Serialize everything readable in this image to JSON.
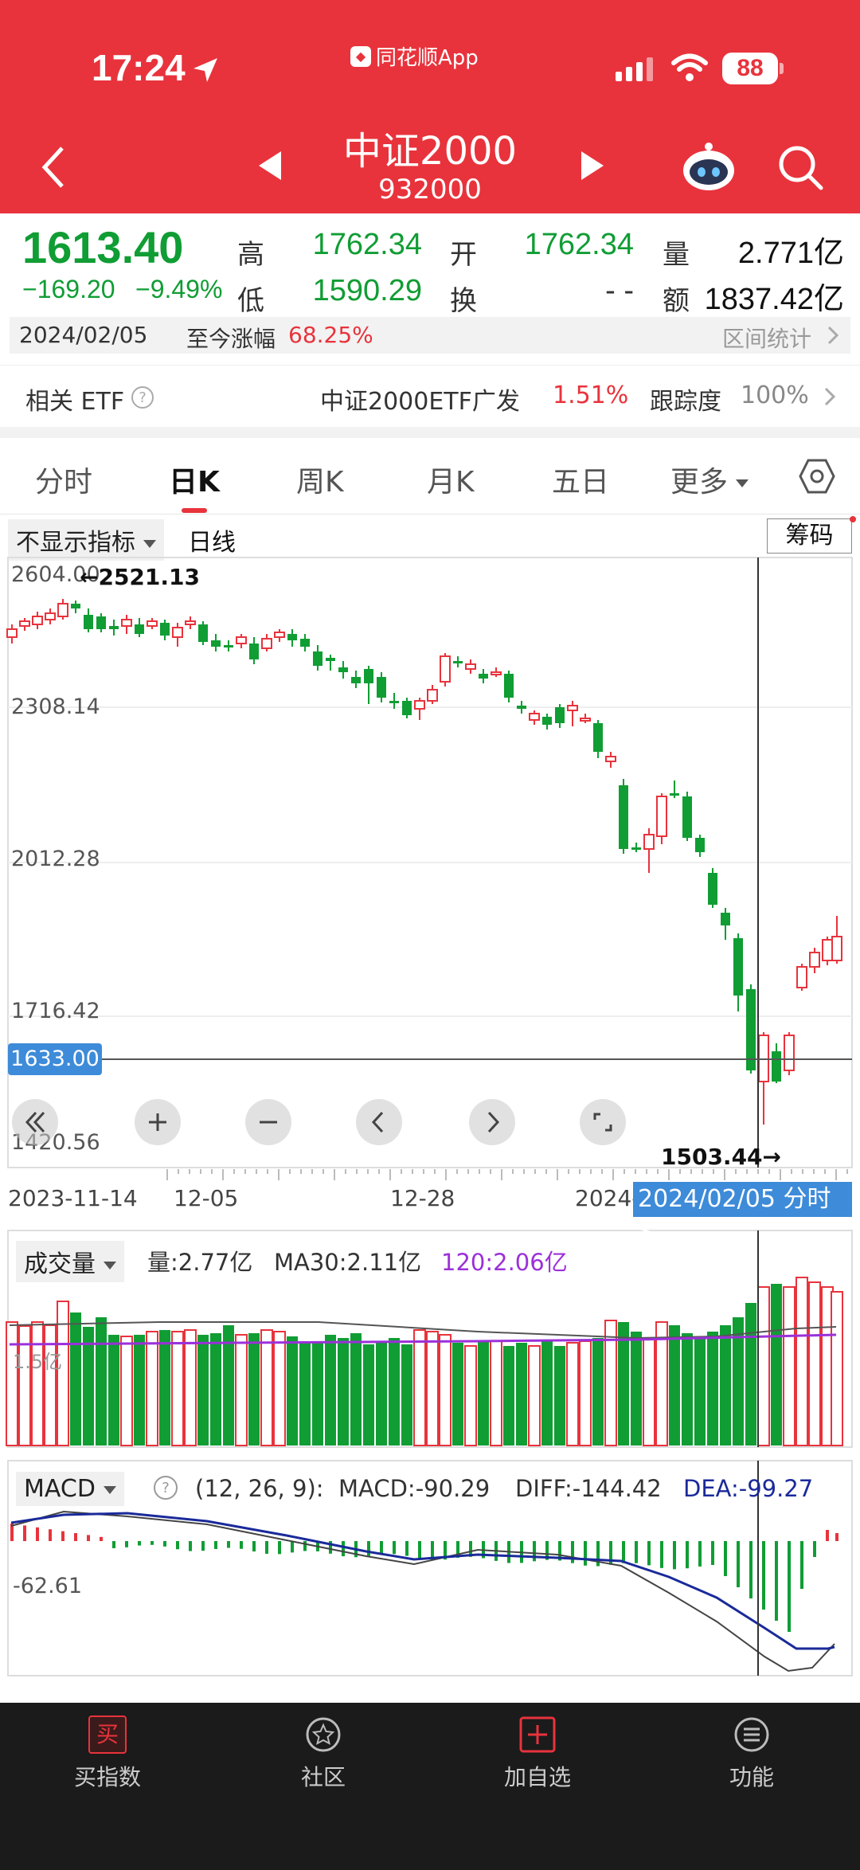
{
  "status": {
    "time": "17:24",
    "app_source": "同花顺App",
    "battery": "88"
  },
  "header": {
    "title": "中证2000",
    "code": "932000"
  },
  "quote": {
    "price": "1613.40",
    "change": "−169.20",
    "change_pct": "−9.49%",
    "high_label": "高",
    "high": "1762.34",
    "low_label": "低",
    "low": "1590.29",
    "open_label": "开",
    "open": "1762.34",
    "turnover_label": "换",
    "turnover": "- -",
    "volume_label": "量",
    "volume": "2.771亿",
    "amount_label": "额",
    "amount": "1837.42亿",
    "date": "2024/02/05",
    "since_label": "至今涨幅",
    "since_value": "68.25%",
    "range_stats": "区间统计"
  },
  "etf": {
    "label": "相关 ETF",
    "name": "中证2000ETF广发",
    "change": "1.51%",
    "track_label": "跟踪度",
    "track_value": "100%"
  },
  "tabs": [
    "分时",
    "日K",
    "周K",
    "月K",
    "五日",
    "更多"
  ],
  "kline": {
    "indicator_select": "不显示指标",
    "line_label": "日线",
    "chip_button": "筹码",
    "max_marker": "2521.13",
    "min_marker": "1503.44",
    "cursor_price": "1633.00",
    "y_ticks": [
      "2604.00",
      "2308.14",
      "2012.28",
      "1716.42",
      "1420.56"
    ]
  },
  "date_axis": [
    "2023-11-14",
    "12-05",
    "12-28",
    "2024-"
  ],
  "date_pill": "2024/02/05 分时 >",
  "volume_panel": {
    "select": "成交量",
    "vol": "量:2.77亿",
    "ma30": "MA30:2.11亿",
    "ma120": "120:2.06亿",
    "axis": "1.5亿"
  },
  "macd_panel": {
    "select": "MACD",
    "params": "(12, 26, 9):",
    "macd": "MACD:-90.29",
    "diff": "DIFF:-144.42",
    "dea": "DEA:-99.27",
    "axis": "-62.61"
  },
  "nav": [
    {
      "label": "买指数",
      "icon": "buy-icon",
      "glyph": "买"
    },
    {
      "label": "社区",
      "icon": "community-icon"
    },
    {
      "label": "加自选",
      "icon": "add-watchlist-icon"
    },
    {
      "label": "功能",
      "icon": "menu-icon"
    }
  ],
  "colors": {
    "brand": "#e8333c",
    "down": "#109d34",
    "up": "#e8333c",
    "cursor": "#3d8bd9"
  }
}
